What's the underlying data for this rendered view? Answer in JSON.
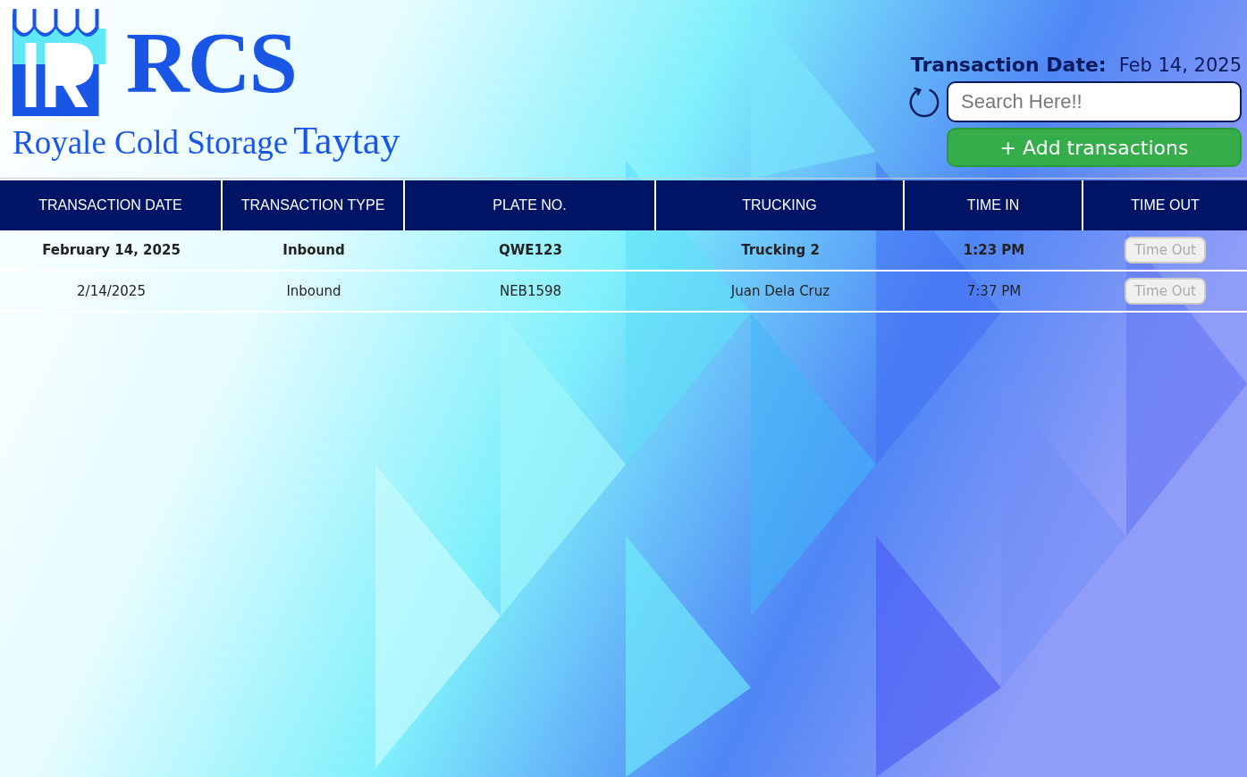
{
  "logo": {
    "mark": "RCS",
    "name": "Royale Cold Storage",
    "branch": "Taytay"
  },
  "transaction_date": {
    "label": "Transaction Date:",
    "value": "Feb 14, 2025"
  },
  "search": {
    "placeholder": "Search Here!!"
  },
  "add_button": {
    "label": "+ Add transactions"
  },
  "table": {
    "columns": [
      "TRANSACTION DATE",
      "TRANSACTION TYPE",
      "PLATE NO.",
      "TRUCKING",
      "TIME IN",
      "TIME OUT"
    ],
    "rows": [
      {
        "bold": true,
        "cells": [
          "February 14, 2025",
          "Inbound",
          "QWE123",
          "Trucking 2",
          "1:23 PM"
        ],
        "action": {
          "label": "Time Out",
          "disabled": true
        }
      },
      {
        "bold": false,
        "cells": [
          "2/14/2025",
          "Inbound",
          "NEB1598",
          "Juan Dela Cruz",
          "7:37 PM"
        ],
        "action": {
          "label": "Time Out",
          "disabled": true
        }
      }
    ]
  }
}
